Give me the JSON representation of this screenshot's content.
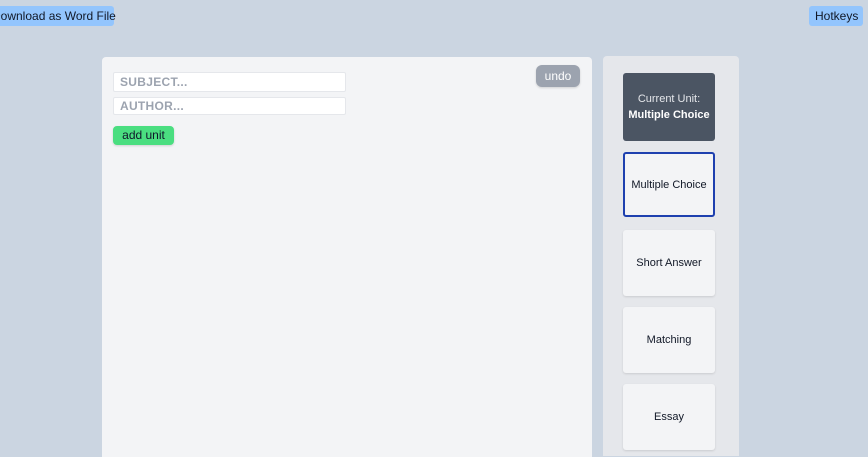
{
  "toolbar": {
    "download_label": "Download as Word File",
    "hotkeys_label": "Hotkeys"
  },
  "editor": {
    "subject_placeholder": "SUBJECT...",
    "author_placeholder": "AUTHOR...",
    "add_unit_label": "add unit",
    "undo_label": "undo"
  },
  "sidebar": {
    "current_unit_label": "Current Unit:",
    "current_unit_value": "Multiple Choice",
    "units": [
      {
        "label": "Multiple Choice",
        "selected": true
      },
      {
        "label": "Short Answer",
        "selected": false
      },
      {
        "label": "Matching",
        "selected": false
      },
      {
        "label": "Essay",
        "selected": false
      }
    ]
  },
  "colors": {
    "background": "#cbd5e1",
    "top_button": "#93c5fd",
    "add_unit": "#4ade80",
    "undo": "#9ca3af",
    "current_unit_card": "#4b5563",
    "selected_border": "#1e40af"
  }
}
